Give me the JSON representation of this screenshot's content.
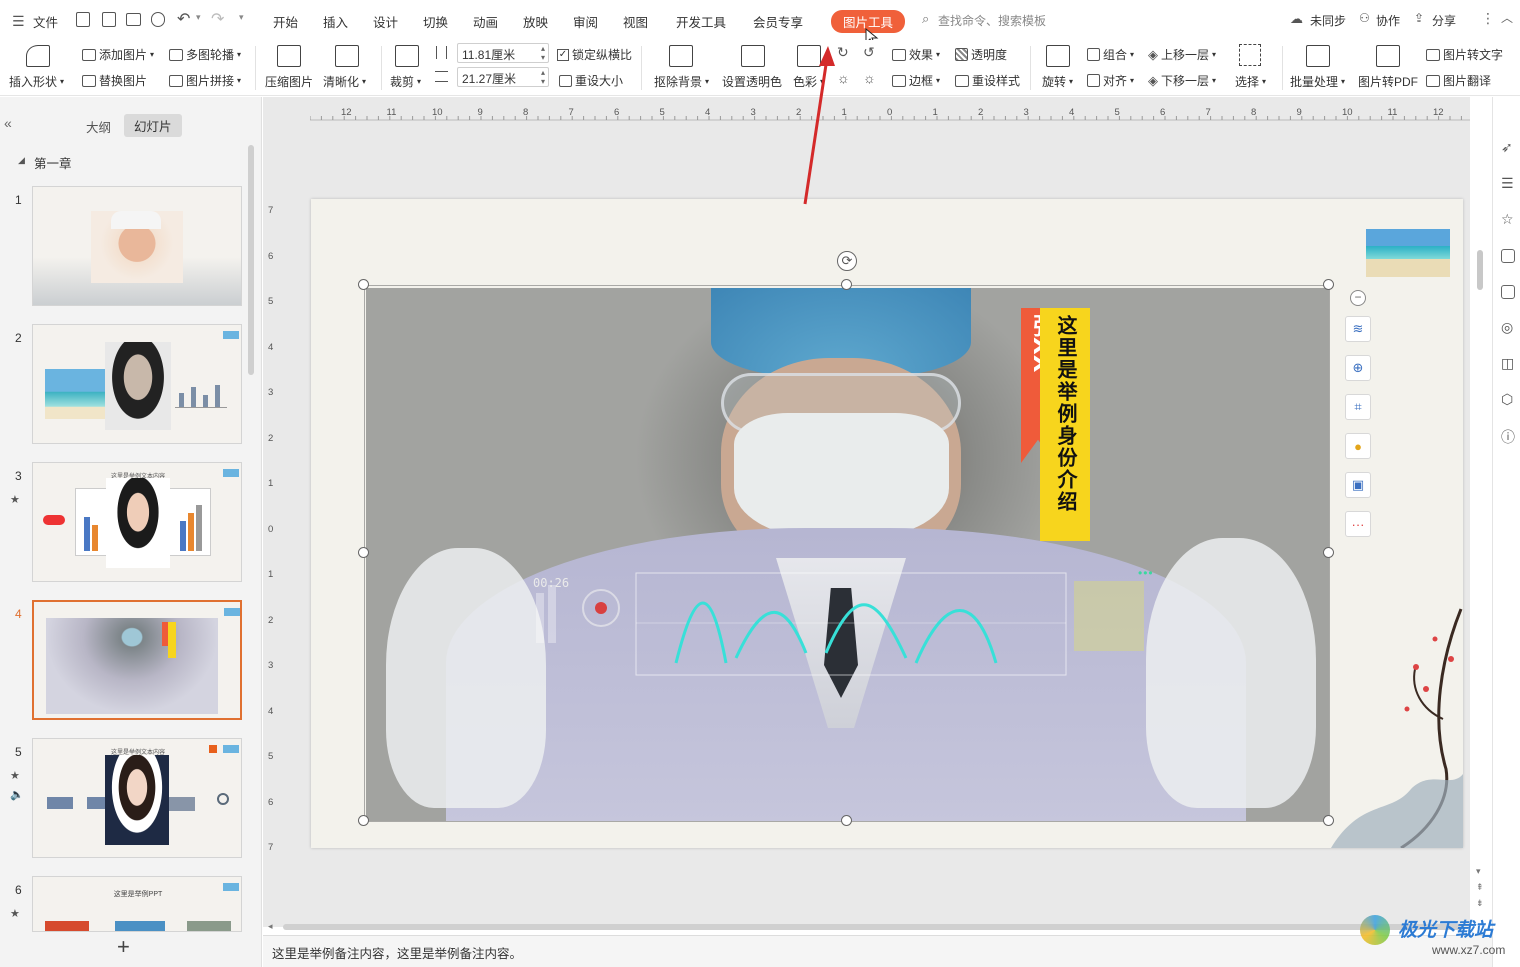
{
  "menubar": {
    "file_label": "文件",
    "tabs": [
      "开始",
      "插入",
      "设计",
      "切换",
      "动画",
      "放映",
      "审阅",
      "视图",
      "开发工具",
      "会员专享",
      "图片工具"
    ],
    "active_tab": "图片工具",
    "search_placeholder": "查找命令、搜索模板",
    "sync_label": "未同步",
    "collab_label": "协作",
    "share_label": "分享"
  },
  "ribbon": {
    "insert_shape": "插入形状",
    "add_picture": "添加图片",
    "multi_carousel": "多图轮播",
    "replace_picture": "替换图片",
    "picture_collage": "图片拼接",
    "compress": "压缩图片",
    "sharpen": "清晰化",
    "crop": "裁剪",
    "height_value": "11.81厘米",
    "width_value": "21.27厘米",
    "lock_ratio": "锁定纵横比",
    "reset_size": "重设大小",
    "remove_bg": "抠除背景",
    "set_transparent": "设置透明色",
    "color": "色彩",
    "effects": "效果",
    "transparency": "透明度",
    "border": "边框",
    "reset_style": "重设样式",
    "rotate": "旋转",
    "group": "组合",
    "align": "对齐",
    "bring_forward": "上移一层",
    "send_backward": "下移一层",
    "select": "选择",
    "batch": "批量处理",
    "to_pdf": "图片转PDF",
    "to_text": "图片转文字",
    "translate": "图片翻译"
  },
  "leftpanel": {
    "tab_outline": "大纲",
    "tab_slides": "幻灯片",
    "section_title": "第一章",
    "slides": [
      {
        "num": "1",
        "star": false,
        "sound": false,
        "caption": ""
      },
      {
        "num": "2",
        "star": false,
        "sound": false,
        "caption": ""
      },
      {
        "num": "3",
        "star": true,
        "sound": false,
        "caption": "这里是举例文本内容"
      },
      {
        "num": "4",
        "star": false,
        "sound": false,
        "caption": ""
      },
      {
        "num": "5",
        "star": true,
        "sound": true,
        "caption": "这里是举例文本内容"
      },
      {
        "num": "6",
        "star": true,
        "sound": false,
        "caption": "这里是举例PPT"
      }
    ],
    "add_slide": "+"
  },
  "ruler": {
    "h_ticks": [
      "12",
      "11",
      "10",
      "9",
      "8",
      "7",
      "6",
      "5",
      "4",
      "3",
      "2",
      "1",
      "0",
      "1",
      "2",
      "3",
      "4",
      "5",
      "6",
      "7",
      "8",
      "9",
      "10",
      "11",
      "12"
    ],
    "v_ticks": [
      "7",
      "6",
      "5",
      "4",
      "3",
      "2",
      "1",
      "0",
      "1",
      "2",
      "3",
      "4",
      "5",
      "6",
      "7"
    ]
  },
  "slide": {
    "banner_name": "张XX",
    "banner_text": "这里是举例身份介绍",
    "hud_time": "00:26",
    "hud_dots": "•••"
  },
  "notes": {
    "text": "这里是举例备注内容，这里是举例备注内容。"
  },
  "watermark": {
    "brand": "极光下载站",
    "url": "www.xz7.com"
  },
  "colors": {
    "accent": "#f0603a",
    "selected_thumb": "#e07030",
    "arrow": "#d42a2a",
    "banner_yellow": "#f7d51d",
    "banner_red": "#ef5b3a"
  }
}
